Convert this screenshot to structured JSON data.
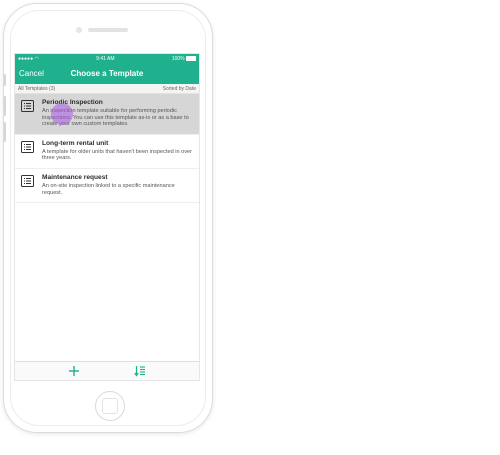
{
  "status_bar": {
    "carrier": "●●●●● ",
    "time": "9:41 AM",
    "battery": "100%"
  },
  "nav": {
    "cancel": "Cancel",
    "title": "Choose a Template"
  },
  "subheader": {
    "left": "All Templates (3)",
    "right": "Sorted by Date"
  },
  "templates": [
    {
      "title": "Periodic Inspection",
      "description": "An inspection template suitable for performing periodic inspections. You can use this template as-is or as a base to create your own custom templates."
    },
    {
      "title": "Long-term rental unit",
      "description": "A template for older units that haven't been inspected in over three years."
    },
    {
      "title": "Maintenance request",
      "description": "An on-site inspection linked to a specific maintenance request."
    }
  ],
  "colors": {
    "accent": "#1fb08d",
    "selected_row": "#d6d6d6",
    "touch_indicator": "#aa5ae6"
  },
  "icons": {
    "template": "list-document-icon",
    "add": "plus-icon",
    "sort": "sort-icon"
  }
}
